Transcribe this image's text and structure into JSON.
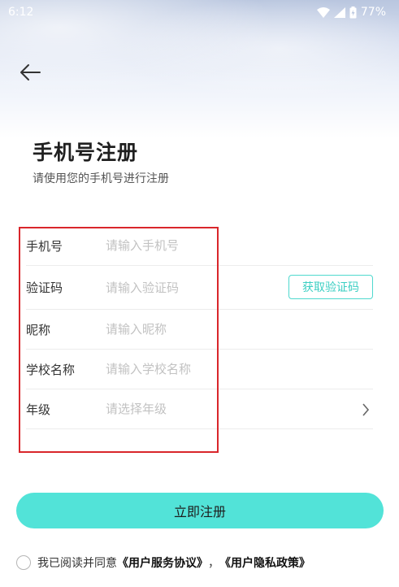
{
  "status_bar": {
    "time": "6:12",
    "battery": "77%"
  },
  "header": {
    "title": "手机号注册",
    "subtitle": "请使用您的手机号进行注册"
  },
  "form": {
    "phone": {
      "label": "手机号",
      "placeholder": "请输入手机号"
    },
    "code": {
      "label": "验证码",
      "placeholder": "请输入验证码",
      "button": "获取验证码"
    },
    "nickname": {
      "label": "昵称",
      "placeholder": "请输入昵称"
    },
    "school": {
      "label": "学校名称",
      "placeholder": "请输入学校名称"
    },
    "grade": {
      "label": "年级",
      "placeholder": "请选择年级"
    }
  },
  "submit_label": "立即注册",
  "agreement": {
    "prefix": "我已阅读并同意",
    "service": "《用户服务协议》",
    "separator": "，",
    "privacy": "《用户隐私政策》"
  },
  "colors": {
    "accent": "#52e3d8",
    "highlight": "#d9262b"
  }
}
